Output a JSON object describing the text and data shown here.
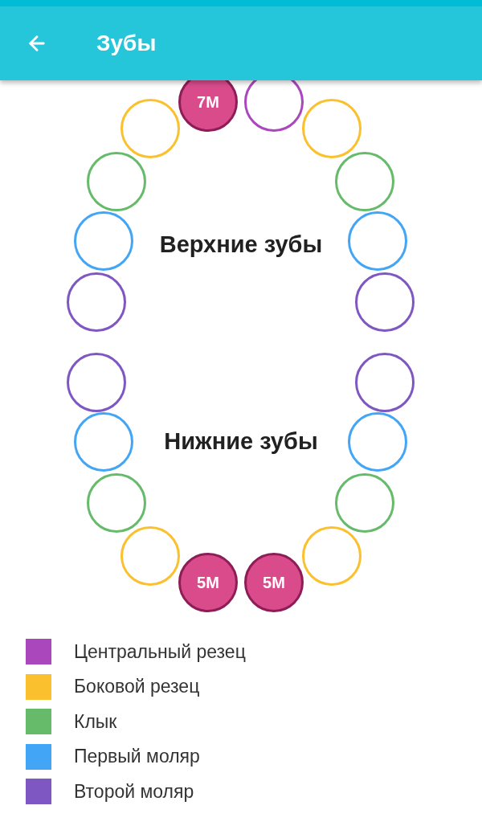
{
  "app_bar": {
    "title": "Зубы"
  },
  "upper_teeth": {
    "label": "Верхние зубы",
    "teeth": [
      {
        "color": "#7e57c2",
        "marked": false
      },
      {
        "color": "#42a5f5",
        "marked": false
      },
      {
        "color": "#66bb6a",
        "marked": false
      },
      {
        "color": "#fbc02d",
        "marked": false
      },
      {
        "marked": true,
        "label": "7M"
      },
      {
        "color": "#ab47bc",
        "marked": false
      },
      {
        "color": "#fbc02d",
        "marked": false
      },
      {
        "color": "#66bb6a",
        "marked": false
      },
      {
        "color": "#42a5f5",
        "marked": false
      },
      {
        "color": "#7e57c2",
        "marked": false
      }
    ]
  },
  "lower_teeth": {
    "label": "Нижние зубы",
    "teeth": [
      {
        "color": "#7e57c2",
        "marked": false
      },
      {
        "color": "#42a5f5",
        "marked": false
      },
      {
        "color": "#66bb6a",
        "marked": false
      },
      {
        "color": "#fbc02d",
        "marked": false
      },
      {
        "marked": true,
        "label": "5M"
      },
      {
        "marked": true,
        "label": "5M"
      },
      {
        "color": "#fbc02d",
        "marked": false
      },
      {
        "color": "#66bb6a",
        "marked": false
      },
      {
        "color": "#42a5f5",
        "marked": false
      },
      {
        "color": "#7e57c2",
        "marked": false
      }
    ]
  },
  "legend": [
    {
      "label": "Центральный резец",
      "color": "#ab47bc"
    },
    {
      "label": "Боковой резец",
      "color": "#fbc02d"
    },
    {
      "label": "Клык",
      "color": "#66bb6a"
    },
    {
      "label": "Первый моляр",
      "color": "#42a5f5"
    },
    {
      "label": "Второй моляр",
      "color": "#7e57c2"
    }
  ]
}
